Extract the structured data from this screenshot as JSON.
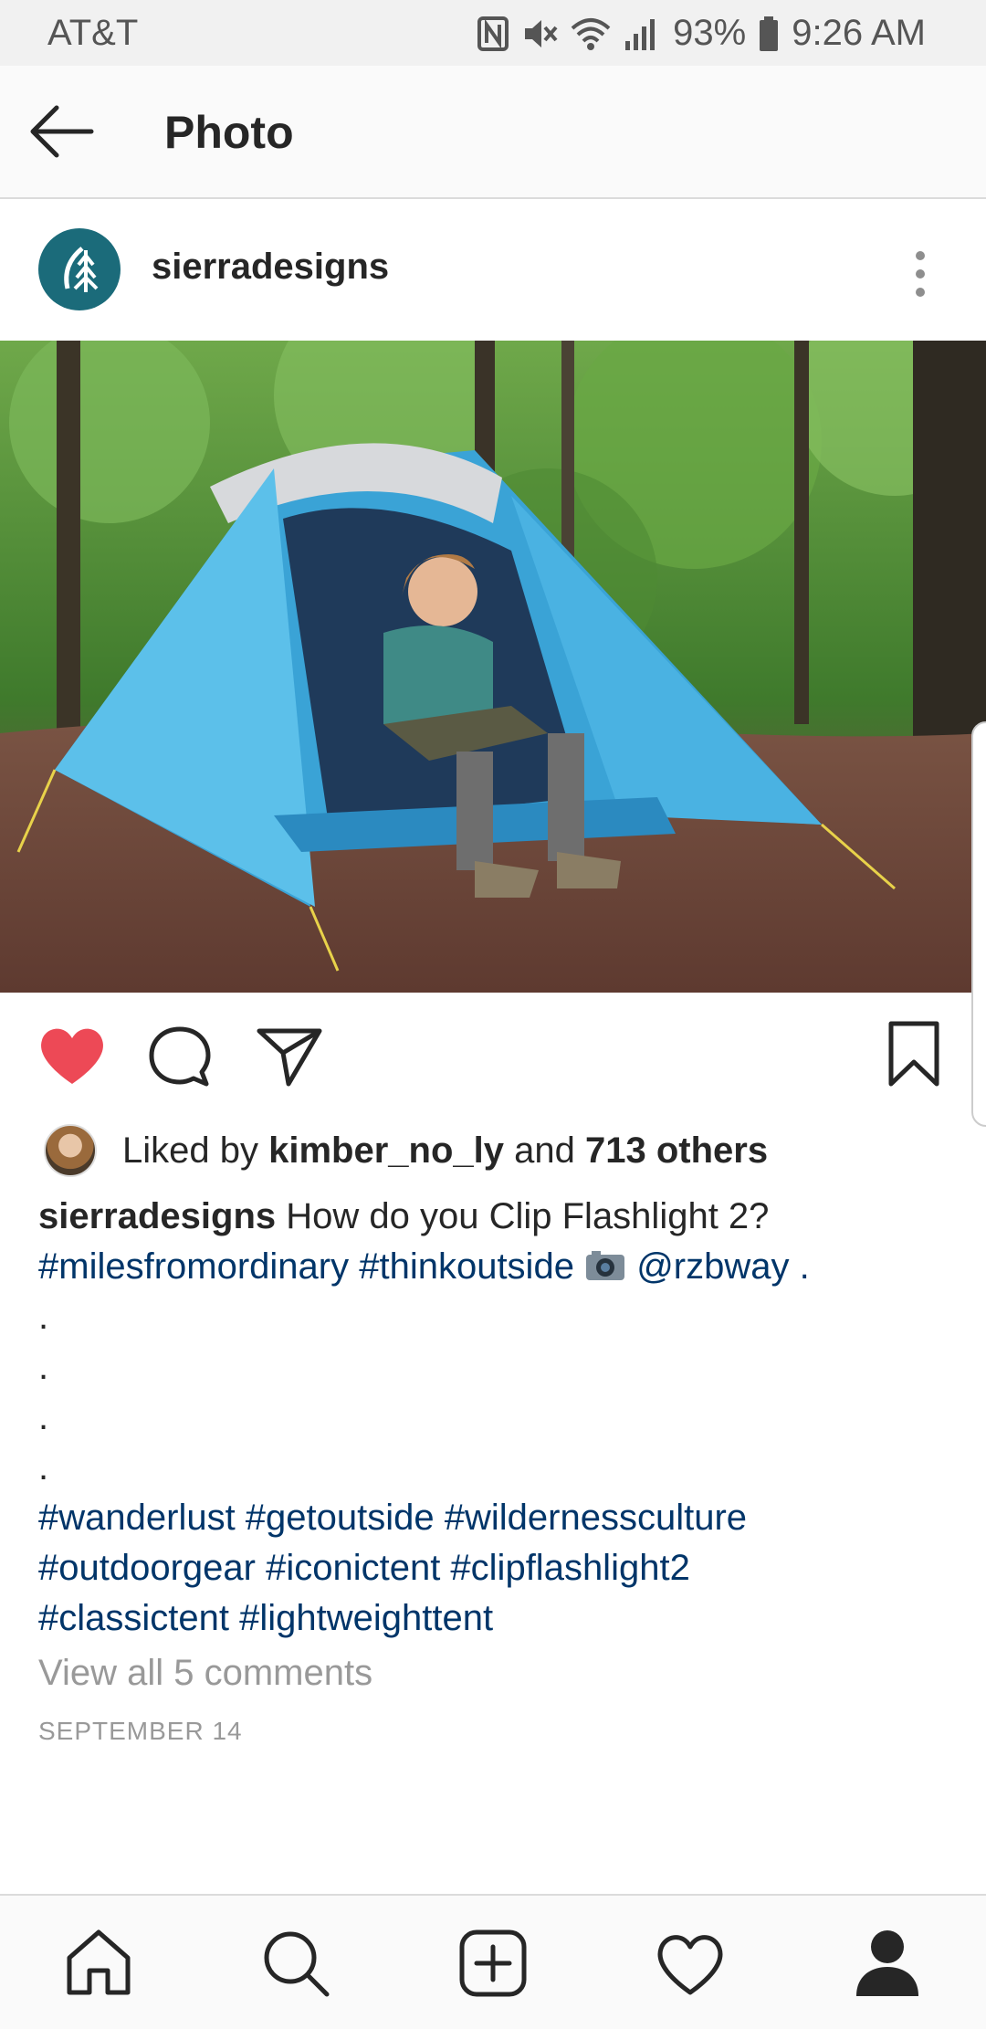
{
  "status_bar": {
    "carrier": "AT&T",
    "battery": "93%",
    "time": "9:26 AM"
  },
  "top_bar": {
    "title": "Photo"
  },
  "post": {
    "username": "sierradesigns",
    "liked": true,
    "likes": {
      "prefix": "Liked by ",
      "user": "kimber_no_ly",
      "middle": " and ",
      "others": "713 others"
    },
    "caption": {
      "username": "sierradesigns",
      "text": " How do you Clip Flashlight 2?",
      "line2_tags": "#milesfromordinary #thinkoutside",
      "line2_mention": "@rzbway",
      "line2_end": " .",
      "dots": [
        ".",
        ".",
        ".",
        "."
      ],
      "tags_line1": "#wanderlust #getoutside #wildernessculture",
      "tags_line2": "#outdoorgear #iconictent #clipflashlight2",
      "tags_line3": "#classictent #lightweighttent"
    },
    "view_comments": "View all 5 comments",
    "date": "SEPTEMBER 14"
  },
  "colors": {
    "heart": "#ed4956",
    "hashtag": "#003569",
    "muted": "#999999",
    "brand_avatar": "#1b6b7a"
  },
  "icons": {
    "back": "arrow-left-icon",
    "more": "vertical-dots-icon",
    "like": "heart-filled-icon",
    "comment": "speech-bubble-icon",
    "share": "paper-plane-icon",
    "save": "bookmark-icon",
    "nav": [
      "home-icon",
      "search-icon",
      "add-post-icon",
      "activity-heart-icon",
      "profile-icon"
    ]
  }
}
